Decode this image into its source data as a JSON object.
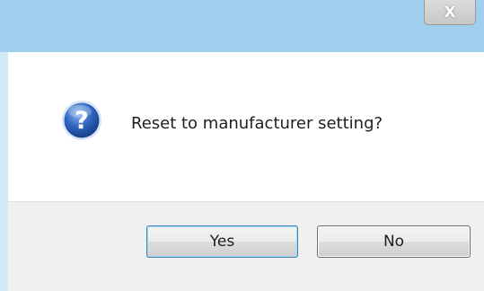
{
  "window": {
    "title": "",
    "close_label": "X"
  },
  "dialog": {
    "icon": "question-icon",
    "message": "Reset to manufacturer setting?"
  },
  "buttons": {
    "yes_label": "Yes",
    "no_label": "No"
  },
  "colors": {
    "title_bar": "#9ed0ee",
    "footer": "#f0f0f0",
    "default_button_border": "#3c7fb1",
    "icon_blue": "#2e66c0"
  }
}
